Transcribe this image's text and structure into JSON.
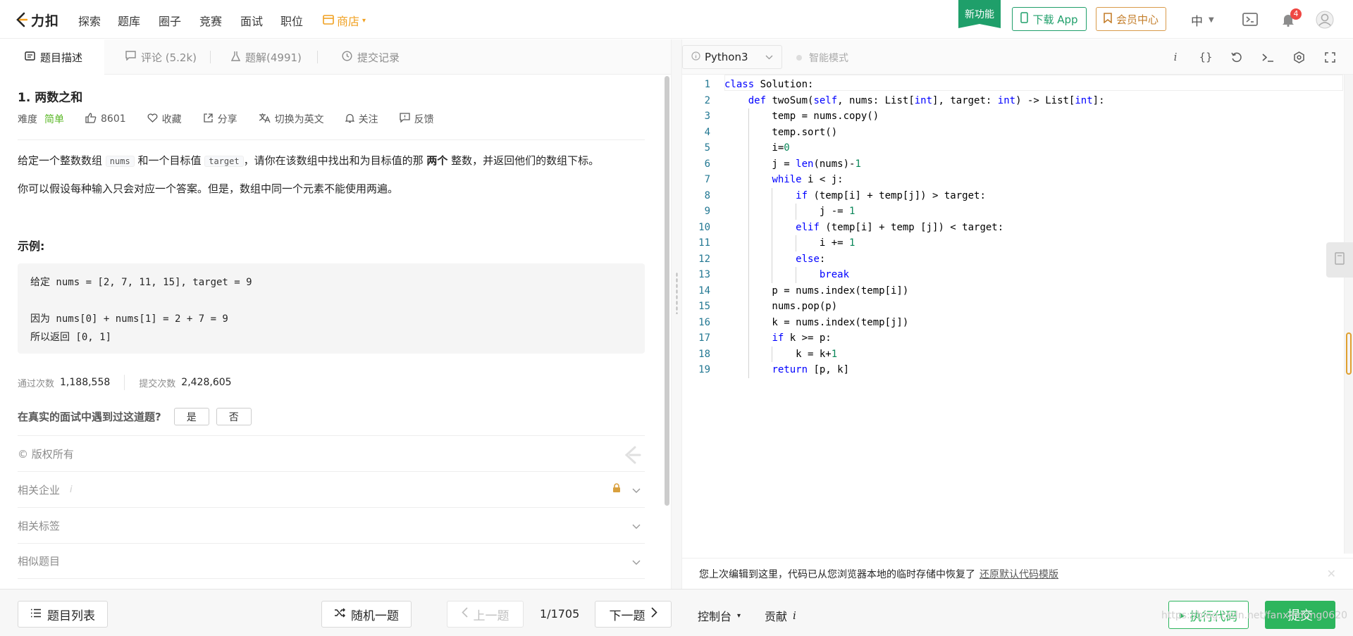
{
  "nav": {
    "logo_text": "力扣",
    "items": [
      "探索",
      "题库",
      "圈子",
      "竞赛",
      "面试",
      "职位"
    ],
    "shop": "商店",
    "new_feature": "新功能",
    "download_app": "下载 App",
    "vip_center": "会员中心",
    "language": "中",
    "notification_count": "4",
    "icons": [
      "leetcode-logo-icon",
      "shop-icon",
      "phone-icon",
      "bookmark-icon",
      "terminal-add-icon",
      "bell-icon",
      "avatar-icon"
    ]
  },
  "tabs": [
    {
      "label": "题目描述",
      "icon": "description-icon",
      "active": true
    },
    {
      "label": "评论 (5.2k)",
      "icon": "comment-icon",
      "active": false
    },
    {
      "label": "题解(4991)",
      "icon": "flask-icon",
      "active": false
    },
    {
      "label": "提交记录",
      "icon": "history-icon",
      "active": false
    }
  ],
  "problem": {
    "title": "1. 两数之和",
    "difficulty_label": "难度",
    "difficulty": "简单",
    "likes": "8601",
    "favorite": "收藏",
    "share": "分享",
    "switch_lang": "切换为英文",
    "follow": "关注",
    "feedback": "反馈",
    "desc_p1_a": "给定一个整数数组 ",
    "desc_p1_code1": "nums",
    "desc_p1_b": " 和一个目标值 ",
    "desc_p1_code2": "target",
    "desc_p1_c": "，请你在该数组中找出和为目标值的那 ",
    "desc_p1_bold": "两个",
    "desc_p1_d": " 整数，并返回他们的数组下标。",
    "desc_p2": "你可以假设每种输入只会对应一个答案。但是，数组中同一个元素不能使用两遍。",
    "example_label": "示例:",
    "example_line1": "给定 nums = [2, 7, 11, 15], target = 9",
    "example_line2": "因为 nums[0] + nums[1] = 2 + 7 = 9",
    "example_line3": "所以返回 [0, 1]"
  },
  "stats": {
    "accepted_label": "通过次数",
    "accepted": "1,188,558",
    "submissions_label": "提交次数",
    "submissions": "2,428,605"
  },
  "interview": {
    "question": "在真实的面试中遇到过这道题?",
    "yes": "是",
    "no": "否"
  },
  "accordion": [
    "© 版权所有",
    "相关企业",
    "相关标签",
    "相似题目"
  ],
  "editor": {
    "language": "Python3",
    "smart_mode": "智能模式",
    "toolbar_icons": [
      "info-icon",
      "braces-icon",
      "reset-icon",
      "terminal-icon",
      "settings-icon",
      "fullscreen-icon"
    ],
    "code": [
      "class Solution:",
      "    def twoSum(self, nums: List[int], target: int) -> List[int]:",
      "        temp = nums.copy()",
      "        temp.sort()",
      "        i=0",
      "        j = len(nums)-1",
      "        while i < j:",
      "            if (temp[i] + temp[j]) > target:",
      "                j -= 1",
      "            elif (temp[i] + temp [j]) < target:",
      "                i += 1",
      "            else:",
      "                break",
      "        p = nums.index(temp[i])",
      "        nums.pop(p)",
      "        k = nums.index(temp[j])",
      "        if k >= p:",
      "            k = k+1",
      "        return [p, k]"
    ],
    "restore_msg": "您上次编辑到这里，代码已从您浏览器本地的临时存储中恢复了",
    "restore_link": "还原默认代码模版"
  },
  "bottom": {
    "problem_list": "题目列表",
    "random": "随机一题",
    "prev": "上一题",
    "page": "1/1705",
    "next": "下一题",
    "console": "控制台",
    "contribute": "贡献",
    "run": "执行代码",
    "submit": "提交",
    "watermark": "https://blog.csdn.net/fanxindong0620"
  },
  "colors": {
    "brand_green": "#2db55d",
    "easy_green": "#5ab726",
    "shop_orange": "#f0a020",
    "keyword_blue": "#0000ff",
    "number_green": "#098658"
  }
}
